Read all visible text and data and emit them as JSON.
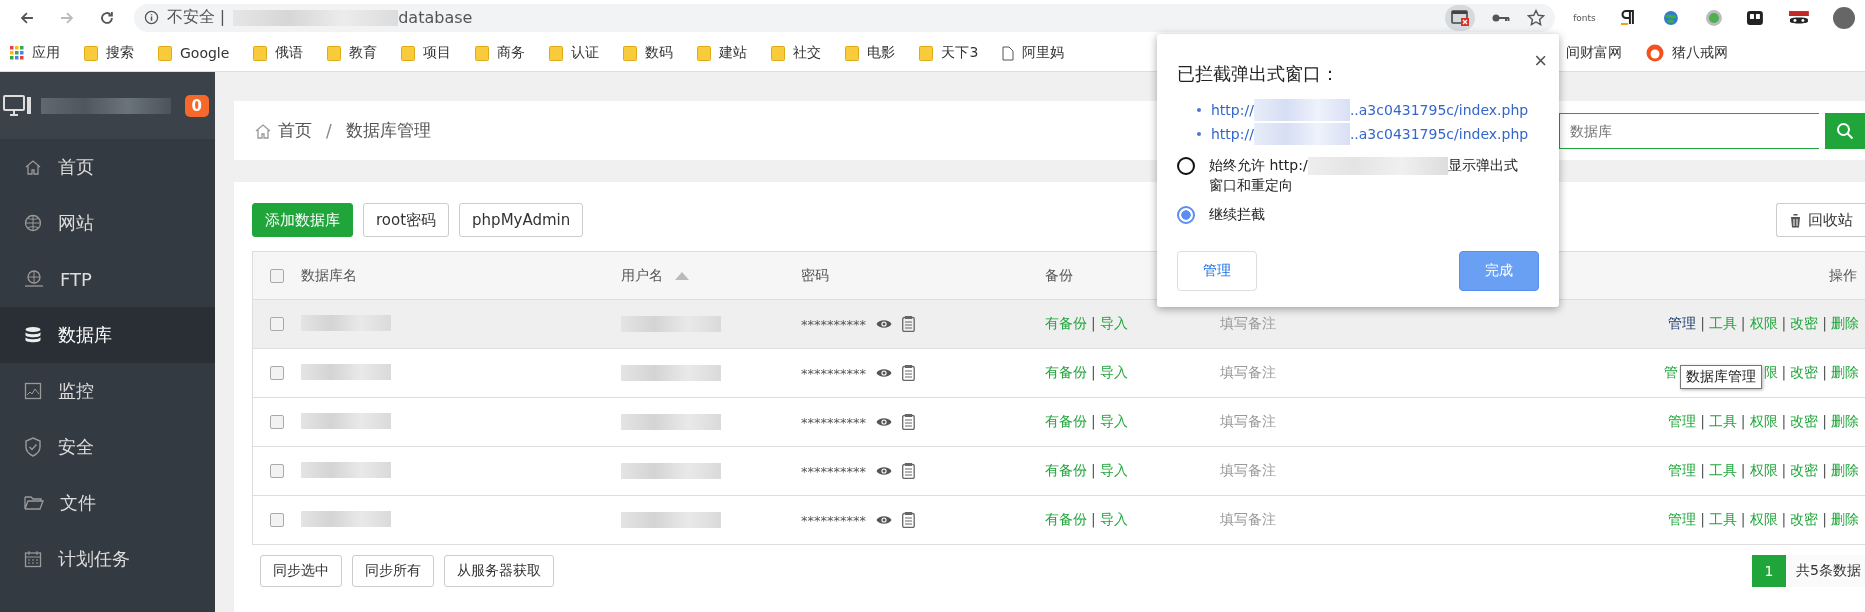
{
  "browser": {
    "security": "不安全 |",
    "address_end": "database",
    "extension_label": "fonts"
  },
  "bookmarks": [
    {
      "label": "应用",
      "kind": "apps"
    },
    {
      "label": "搜索",
      "kind": "folder"
    },
    {
      "label": "Google",
      "kind": "folder"
    },
    {
      "label": "俄语",
      "kind": "folder"
    },
    {
      "label": "教育",
      "kind": "folder"
    },
    {
      "label": "项目",
      "kind": "folder"
    },
    {
      "label": "商务",
      "kind": "folder"
    },
    {
      "label": "认证",
      "kind": "folder"
    },
    {
      "label": "数码",
      "kind": "folder"
    },
    {
      "label": "建站",
      "kind": "folder"
    },
    {
      "label": "社交",
      "kind": "folder"
    },
    {
      "label": "电影",
      "kind": "folder"
    },
    {
      "label": "天下3",
      "kind": "folder"
    },
    {
      "label": "阿里妈",
      "kind": "page"
    },
    {
      "label": "间财富网",
      "kind": "none"
    },
    {
      "label": "猪八戒网",
      "kind": "site"
    }
  ],
  "sidebar": {
    "badge": "0",
    "items": [
      {
        "label": "首页",
        "selected": false
      },
      {
        "label": "网站",
        "selected": false
      },
      {
        "label": "FTP",
        "selected": false
      },
      {
        "label": "数据库",
        "selected": true
      },
      {
        "label": "监控",
        "selected": false
      },
      {
        "label": "安全",
        "selected": false
      },
      {
        "label": "文件",
        "selected": false
      },
      {
        "label": "计划任务",
        "selected": false
      }
    ]
  },
  "breadcrumb": [
    {
      "label": "首页",
      "kind": "link"
    },
    {
      "label": "/",
      "kind": "separator"
    },
    {
      "label": "数据库管理",
      "kind": "link"
    }
  ],
  "search": {
    "placeholder": "数据库"
  },
  "toolbar": {
    "buttons": [
      {
        "label": "添加数据库",
        "kind": "primary"
      },
      {
        "label": "root密码",
        "kind": "default"
      },
      {
        "label": "phpMyAdmin",
        "kind": "default"
      }
    ],
    "recycle": "回收站"
  },
  "table": {
    "header_checked": false,
    "columns": [
      {
        "label": "数据库名"
      },
      {
        "label": "用户名",
        "sorted": true
      },
      {
        "label": "密码"
      },
      {
        "label": "备份"
      },
      {
        "label": "操作"
      }
    ],
    "rows": [
      {
        "checked": false,
        "hovered": true,
        "password": "**********",
        "note": "填写备注",
        "backup": [
          {
            "label": "有备份",
            "kind": "link"
          },
          {
            "label": "|",
            "kind": "separator"
          },
          {
            "label": "导入",
            "kind": "link"
          }
        ],
        "actions": [
          {
            "label": "管理",
            "kind": "hover"
          },
          {
            "label": "|",
            "kind": "separator"
          },
          {
            "label": "工具",
            "kind": "link"
          },
          {
            "label": "|",
            "kind": "separator"
          },
          {
            "label": "权限",
            "kind": "link"
          },
          {
            "label": "|",
            "kind": "separator"
          },
          {
            "label": "改密",
            "kind": "link"
          },
          {
            "label": "|",
            "kind": "separator"
          },
          {
            "label": "删除",
            "kind": "link"
          }
        ]
      },
      {
        "checked": false,
        "hovered": false,
        "password": "**********",
        "note": "填写备注",
        "backup": [
          {
            "label": "有备份",
            "kind": "link"
          },
          {
            "label": "|",
            "kind": "separator"
          },
          {
            "label": "导入",
            "kind": "link"
          }
        ],
        "actions": [
          {
            "label": "管",
            "kind": "link"
          },
          {
            "label": "数据库管理",
            "kind": "tooltip"
          },
          {
            "label": "限",
            "kind": "link"
          },
          {
            "label": "|",
            "kind": "separator"
          },
          {
            "label": "改密",
            "kind": "link"
          },
          {
            "label": "|",
            "kind": "separator"
          },
          {
            "label": "删除",
            "kind": "link"
          }
        ]
      },
      {
        "checked": false,
        "hovered": false,
        "password": "**********",
        "note": "填写备注",
        "backup": [
          {
            "label": "有备份",
            "kind": "link"
          },
          {
            "label": "|",
            "kind": "separator"
          },
          {
            "label": "导入",
            "kind": "link"
          }
        ],
        "actions": [
          {
            "label": "管理",
            "kind": "link"
          },
          {
            "label": "|",
            "kind": "separator"
          },
          {
            "label": "工具",
            "kind": "link"
          },
          {
            "label": "|",
            "kind": "separator"
          },
          {
            "label": "权限",
            "kind": "link"
          },
          {
            "label": "|",
            "kind": "separator"
          },
          {
            "label": "改密",
            "kind": "link"
          },
          {
            "label": "|",
            "kind": "separator"
          },
          {
            "label": "删除",
            "kind": "link"
          }
        ]
      },
      {
        "checked": false,
        "hovered": false,
        "password": "**********",
        "note": "填写备注",
        "backup": [
          {
            "label": "有备份",
            "kind": "link"
          },
          {
            "label": "|",
            "kind": "separator"
          },
          {
            "label": "导入",
            "kind": "link"
          }
        ],
        "actions": [
          {
            "label": "管理",
            "kind": "link"
          },
          {
            "label": "|",
            "kind": "separator"
          },
          {
            "label": "工具",
            "kind": "link"
          },
          {
            "label": "|",
            "kind": "separator"
          },
          {
            "label": "权限",
            "kind": "link"
          },
          {
            "label": "|",
            "kind": "separator"
          },
          {
            "label": "改密",
            "kind": "link"
          },
          {
            "label": "|",
            "kind": "separator"
          },
          {
            "label": "删除",
            "kind": "link"
          }
        ]
      },
      {
        "checked": false,
        "hovered": false,
        "password": "**********",
        "note": "填写备注",
        "backup": [
          {
            "label": "有备份",
            "kind": "link"
          },
          {
            "label": "|",
            "kind": "separator"
          },
          {
            "label": "导入",
            "kind": "link"
          }
        ],
        "actions": [
          {
            "label": "管理",
            "kind": "link"
          },
          {
            "label": "|",
            "kind": "separator"
          },
          {
            "label": "工具",
            "kind": "link"
          },
          {
            "label": "|",
            "kind": "separator"
          },
          {
            "label": "权限",
            "kind": "link"
          },
          {
            "label": "|",
            "kind": "separator"
          },
          {
            "label": "改密",
            "kind": "link"
          },
          {
            "label": "|",
            "kind": "separator"
          },
          {
            "label": "删除",
            "kind": "link"
          }
        ]
      }
    ]
  },
  "footer": {
    "buttons": [
      "同步选中",
      "同步所有",
      "从服务器获取"
    ],
    "pages": [
      {
        "label": "1",
        "selected": true
      }
    ],
    "total": "共5条数据"
  },
  "popup": {
    "title": "已拦截弹出式窗口：",
    "close": "×",
    "links": [
      {
        "start": "http://",
        "end": "..a3c0431795c/index.php"
      },
      {
        "start": "http://",
        "end": "..a3c0431795c/index.php"
      }
    ],
    "options": [
      {
        "start": "始终允许 http:/",
        "end": "显示弹出式窗口和重定向",
        "selected": false
      },
      {
        "start": "继续拦截",
        "selected": true
      }
    ],
    "buttons": [
      {
        "label": "管理",
        "kind": "default"
      },
      {
        "label": "完成",
        "kind": "primary"
      }
    ]
  }
}
